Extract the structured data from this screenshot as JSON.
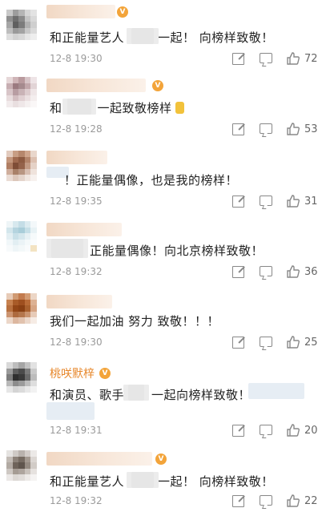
{
  "colors": {
    "accent": "#e7872b",
    "muted": "#9a9a9a",
    "text": "#222222"
  },
  "comments": [
    {
      "username": "",
      "text_a": "和正能量艺人",
      "text_b": "一起！ 向榜样致敬！",
      "time": "12-8 19:30",
      "likes": "72"
    },
    {
      "username": "",
      "text_a": "和",
      "text_b": "一起致敬榜样",
      "time": "12-8 19:28",
      "likes": "53"
    },
    {
      "username": "",
      "text_a": "",
      "text_b": "！正能量偶像，也是我的榜样！",
      "time": "12-8 19:35",
      "likes": "31"
    },
    {
      "username": "",
      "text_a": "",
      "text_b": "正能量偶像！向北京榜样致敬！",
      "time": "12-8 19:32",
      "likes": "36"
    },
    {
      "username": "",
      "text_a": "我们一起加油 努力 致敬！！！",
      "text_b": "",
      "time": "12-8 19:30",
      "likes": "25"
    },
    {
      "username": "桃咲默梓",
      "text_a": "和演员、歌手",
      "text_b": "一起向榜样致敬！",
      "time": "12-8 19:31",
      "likes": "20"
    },
    {
      "username": "",
      "text_a": "和正能量艺人",
      "text_b": "一起！ 向榜样致敬！",
      "time": "12-8 19:32",
      "likes": "22"
    }
  ],
  "icons": {
    "share": "share-icon",
    "comment": "comment-icon",
    "like": "like-icon",
    "vip": "vip-badge-icon",
    "thumb": "thumbs-up-emoji"
  }
}
